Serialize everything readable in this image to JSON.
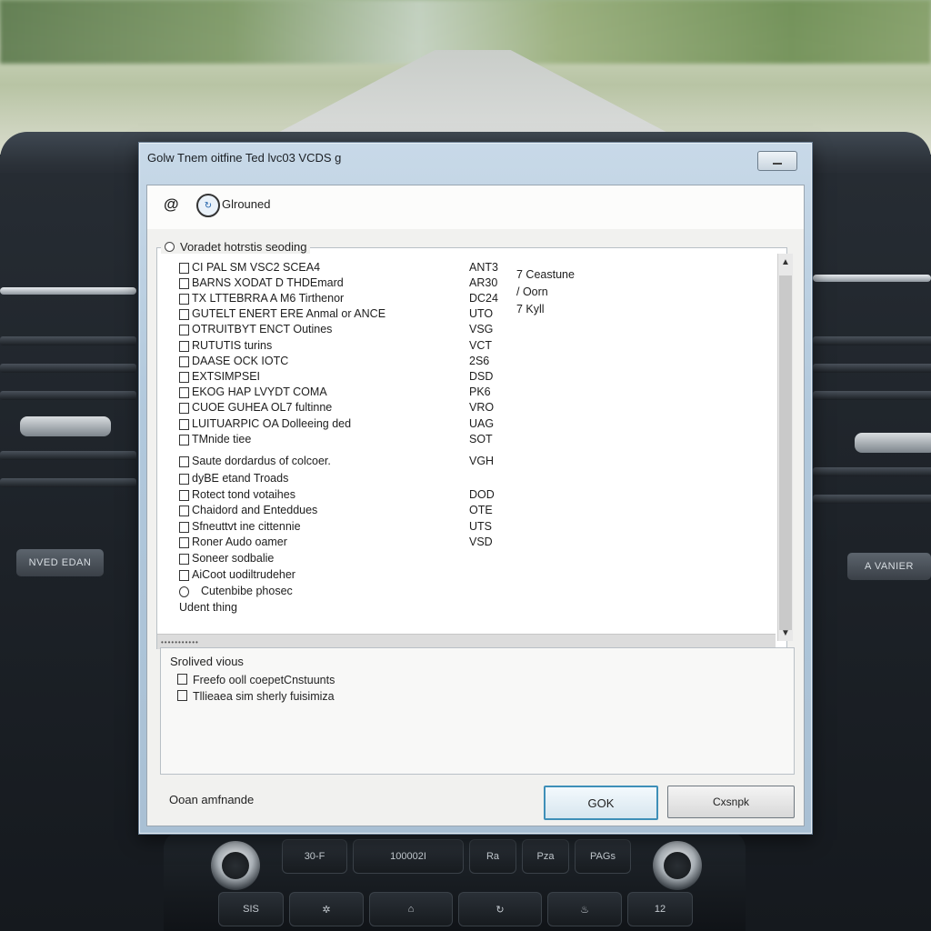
{
  "dialog": {
    "title": "Golw Tnem oitfine Ted lvc03 VCDS g",
    "toolbar_label": "Glrouned",
    "group_label": "Voradet hotrstis seoding",
    "items": [
      {
        "label": "CI PAL SM VSC2 SCEA4",
        "code": "ANT3"
      },
      {
        "label": "BARNS XODAT D THDEmard",
        "code": "AR30"
      },
      {
        "label": "TX LTTEBRRA A M6 Tirthenor",
        "code": "DC24"
      },
      {
        "label": "GUTELT ENERT ERE Anmal or ANCE",
        "code": "UTO"
      },
      {
        "label": "OTRUITBYT ENCT Outines",
        "code": "VSG"
      },
      {
        "label": "RUTUTIS turins",
        "code": "VCT"
      },
      {
        "label": "DAASE OCK IOTC",
        "code": "2S6"
      },
      {
        "label": "EXTSIMPSEI",
        "code": "DSD"
      },
      {
        "label": "EKOG HAP LVYDT COMA",
        "code": "PK6"
      },
      {
        "label": "CUOE GUHEA OL7 fultinne",
        "code": "VRO"
      },
      {
        "label": "LUITUARPIC OA Dolleeing ded",
        "code": "UAG"
      },
      {
        "label": "TMnide tiee",
        "code": "SOT"
      },
      {
        "label": "Saute dordardus of colcoer.",
        "code": "VGH"
      },
      {
        "label": "dyBE etand Troads",
        "code": ""
      },
      {
        "label": "Rotect tond votaihes",
        "code": "DOD"
      },
      {
        "label": "Chaidord and Enteddues",
        "code": "OTE"
      },
      {
        "label": "Sfneuttvt ine cittennie",
        "code": "UTS"
      },
      {
        "label": "Roner Audo oamer",
        "code": "VSD"
      },
      {
        "label": "Soneer sodbalie",
        "code": ""
      },
      {
        "label": "AiCoot uodiltrudeher",
        "code": ""
      },
      {
        "label": "Cutenbibe phosec",
        "code": ""
      },
      {
        "label": "Udent thing",
        "code": ""
      }
    ],
    "side_items": [
      "7 Ceastune",
      "/ Oorn",
      "7 Kyll"
    ],
    "lower_title": "Srolived vious",
    "options": [
      "Freefo ooll coepetCnstuunts",
      "Tllieaea sim sherly fuisimiza"
    ],
    "status_text": "Ooan amfnande",
    "ok_label": "GOK",
    "cancel_label": "Cxsnpk"
  },
  "car": {
    "left_badge": "NVED EDAN",
    "right_badge": "A  VANIER",
    "console_top": [
      "30-F",
      "100002I",
      "Ra",
      "Pza",
      "PAGs"
    ],
    "console_bottom": [
      "SIS",
      "",
      "",
      "",
      "",
      "12"
    ]
  }
}
